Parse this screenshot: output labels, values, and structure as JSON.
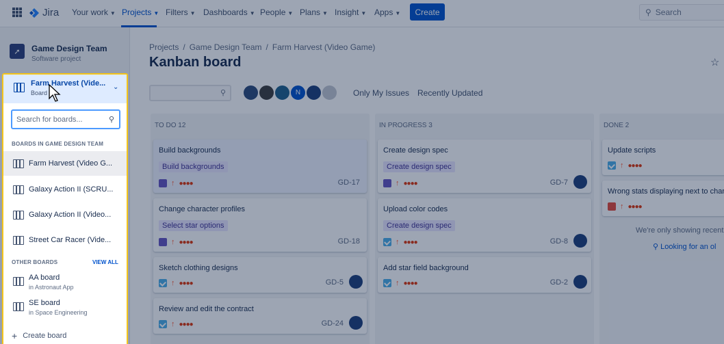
{
  "topbar": {
    "logo": "Jira",
    "nav": [
      "Your work",
      "Projects",
      "Filters",
      "Dashboards",
      "People",
      "Plans",
      "Insight",
      "Apps"
    ],
    "active_nav": "Projects",
    "create_label": "Create",
    "search_placeholder": "Search"
  },
  "sidebar": {
    "project_name": "Game Design Team",
    "project_type": "Software project"
  },
  "main": {
    "breadcrumb": [
      "Projects",
      "Game Design Team",
      "Farm Harvest (Video Game)"
    ],
    "title": "Kanban board",
    "quick_filters": [
      "Only My Issues",
      "Recently Updated"
    ],
    "avatar_initial": "N"
  },
  "columns": [
    {
      "title": "TO DO 12",
      "cards": [
        {
          "title": "Build backgrounds",
          "epic": "Build backgrounds",
          "type": "subtask",
          "key": "GD-17",
          "avatar": false
        },
        {
          "title": "Change character profiles",
          "epic": "Select star options",
          "type": "subtask",
          "key": "GD-18",
          "avatar": false
        },
        {
          "title": "Sketch clothing designs",
          "epic": "",
          "type": "task",
          "key": "GD-5",
          "avatar": true
        },
        {
          "title": "Review and edit the contract",
          "epic": "",
          "type": "task",
          "key": "GD-24",
          "avatar": true
        }
      ]
    },
    {
      "title": "IN PROGRESS 3",
      "cards": [
        {
          "title": "Create design spec",
          "epic": "Create design spec",
          "type": "subtask",
          "key": "GD-7",
          "avatar": true
        },
        {
          "title": "Upload color codes",
          "epic": "Create design spec",
          "type": "task",
          "key": "GD-8",
          "avatar": true
        },
        {
          "title": "Add star field background",
          "epic": "",
          "type": "task",
          "key": "GD-2",
          "avatar": true
        }
      ]
    },
    {
      "title": "DONE 2",
      "cards": [
        {
          "title": "Update scripts",
          "type": "task"
        },
        {
          "title": "Wrong stats displaying next to charac",
          "type": "bug"
        }
      ],
      "note": "We're only showing recently",
      "link": "Looking for an ol"
    }
  ],
  "board_switcher": {
    "current_title": "Farm Harvest (Vide...",
    "current_sub": "Board",
    "search_placeholder": "Search for boards...",
    "section1": "BOARDS IN GAME DESIGN TEAM",
    "boards1": [
      "Farm Harvest (Video G...",
      "Galaxy Action II (SCRU...",
      "Galaxy Action II (Video...",
      "Street Car Racer (Vide..."
    ],
    "section2": "OTHER BOARDS",
    "view_all": "VIEW ALL",
    "boards2": [
      {
        "name": "AA board",
        "sub": "in Astronaut App"
      },
      {
        "name": "SE board",
        "sub": "in Space Engineering"
      }
    ],
    "create_label": "Create board"
  },
  "colors": {
    "accent": "#0052cc",
    "highlight": "#f5c518",
    "overlay": "rgba(9,30,66,0.40)"
  }
}
